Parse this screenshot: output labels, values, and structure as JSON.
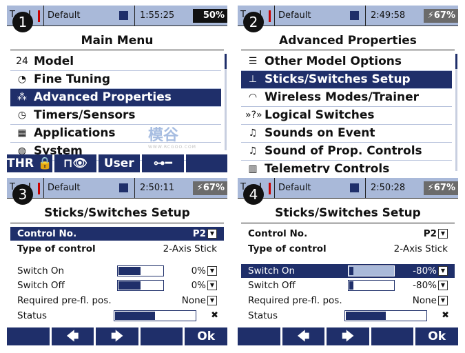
{
  "colors": {
    "accent": "#1f2f6a",
    "status_bar": "#a9b9d9"
  },
  "watermark": {
    "text": "模谷",
    "url_text": "WWW.RCGOO.COM"
  },
  "screens": [
    {
      "badge": "1",
      "status": {
        "model": "Default",
        "time": "1:55:25",
        "battery": "50%",
        "charging": false
      },
      "title": "Main Menu",
      "type": "menu",
      "items": [
        {
          "icon": "2.4ex-icon",
          "glyph": "24",
          "label": "Model"
        },
        {
          "icon": "gauge-icon",
          "glyph": "◔",
          "label": "Fine Tuning"
        },
        {
          "icon": "tree-icon",
          "glyph": "⁂",
          "label": "Advanced Properties",
          "selected": true
        },
        {
          "icon": "clock-icon",
          "glyph": "◷",
          "label": "Timers/Sensors"
        },
        {
          "icon": "grid-icon",
          "glyph": "▦",
          "label": "Applications"
        },
        {
          "icon": "globe-icon",
          "glyph": "◍",
          "label": "System"
        }
      ],
      "bottom": [
        {
          "icon": "lock-icon",
          "label": "THR 🔒"
        },
        {
          "icon": "model-eye-icon",
          "label": "⊓👁"
        },
        {
          "label": "User"
        },
        {
          "icon": "key-icon",
          "label": "⊶━"
        },
        {
          "label": ""
        }
      ]
    },
    {
      "badge": "2",
      "status": {
        "model": "Default",
        "time": "2:49:58",
        "battery": "67%",
        "charging": true
      },
      "title": "Advanced Properties",
      "type": "menu",
      "items": [
        {
          "icon": "sliders-icon",
          "glyph": "☰",
          "label": "Other Model Options"
        },
        {
          "icon": "stick-icon",
          "glyph": "⊥",
          "label": "Sticks/Switches Setup",
          "selected": true
        },
        {
          "icon": "wireless-icon",
          "glyph": "◠",
          "label": "Wireless Modes/Trainer"
        },
        {
          "icon": "logic-icon",
          "glyph": "»?»",
          "label": "Logical Switches"
        },
        {
          "icon": "note-icon",
          "glyph": "♫",
          "label": "Sounds on Event"
        },
        {
          "icon": "note-icon",
          "glyph": "♫",
          "label": "Sound of Prop. Controls"
        },
        {
          "icon": "telemetry-icon",
          "glyph": "▥",
          "label": "Telemetry Controls"
        }
      ]
    },
    {
      "badge": "3",
      "status": {
        "model": "Default",
        "time": "2:50:11",
        "battery": "67%",
        "charging": true
      },
      "title": "Sticks/Switches Setup",
      "type": "setup",
      "selected": "control",
      "control_label": "Control No.",
      "control_value": "P2",
      "type_label": "Type of control",
      "type_value": "2-Axis Stick",
      "switch_on_label": "Switch On",
      "switch_on_value": "0%",
      "switch_on_pct": 0,
      "switch_off_label": "Switch Off",
      "switch_off_value": "0%",
      "switch_off_pct": 0,
      "prefl_label": "Required pre-fl. pos.",
      "prefl_value": "None",
      "status_label": "Status",
      "status_fill": 0.5,
      "status_mark": "✖",
      "bottom": [
        {
          "label": ""
        },
        {
          "icon": "arrow-left-icon",
          "label": "🡄"
        },
        {
          "icon": "arrow-right-icon",
          "label": "🡆"
        },
        {
          "label": ""
        },
        {
          "label": "Ok"
        }
      ]
    },
    {
      "badge": "4",
      "status": {
        "model": "Default",
        "time": "2:50:28",
        "battery": "67%",
        "charging": true
      },
      "title": "Sticks/Switches Setup",
      "type": "setup",
      "selected": "switch_on",
      "control_label": "Control No.",
      "control_value": "P2",
      "type_label": "Type of control",
      "type_value": "2-Axis Stick",
      "switch_on_label": "Switch On",
      "switch_on_value": "-80%",
      "switch_on_pct": -80,
      "switch_off_label": "Switch Off",
      "switch_off_value": "-80%",
      "switch_off_pct": -80,
      "prefl_label": "Required pre-fl. pos.",
      "prefl_value": "None",
      "status_label": "Status",
      "status_fill": 0.5,
      "status_mark": "✖",
      "bottom": [
        {
          "label": ""
        },
        {
          "icon": "arrow-left-icon",
          "label": "🡄"
        },
        {
          "icon": "arrow-right-icon",
          "label": "🡆"
        },
        {
          "label": ""
        },
        {
          "label": "Ok"
        }
      ]
    }
  ]
}
